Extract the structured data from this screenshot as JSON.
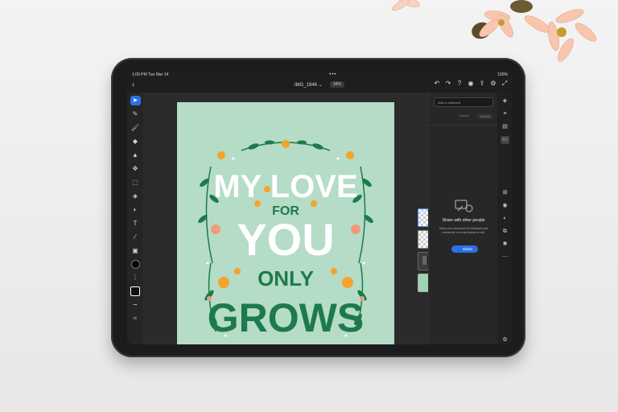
{
  "status": {
    "time": "1:09 PM",
    "date": "Tue Mar 14",
    "battery": "100%"
  },
  "header": {
    "doc_name": "IMG_1946 ⌄",
    "zoom": "34%"
  },
  "artwork": {
    "line1": "MY LOVE",
    "line2": "FOR",
    "line3": "YOU",
    "line4": "ONLY",
    "line5": "GROWS"
  },
  "comments": {
    "placeholder": "Add a comment",
    "cancel_label": "Cancel",
    "submit_label": "Submit",
    "share_title": "Share with other people",
    "share_desc": "Share your document for feedback and comments, or invite people to edit.",
    "share_button": "Share"
  },
  "colors": {
    "artboard_bg": "#b5dcc6",
    "lettering": "#ffffff",
    "dark_green": "#1d7a4b",
    "orange": "#f5a32a",
    "peach": "#f29a7a",
    "accent_blue": "#2f6fe6"
  }
}
